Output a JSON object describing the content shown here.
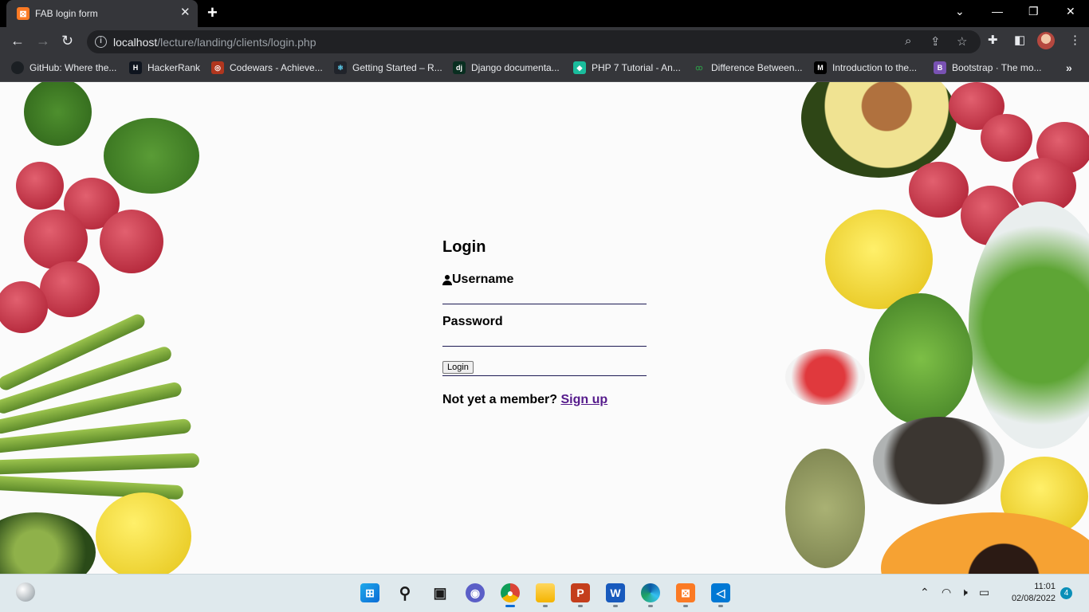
{
  "browser": {
    "tab": {
      "favicon": "xampp-icon",
      "title": "FAB login form",
      "close": "✕"
    },
    "new_tab": "+",
    "window_controls": [
      "⌄",
      "—",
      "❐",
      "✕"
    ],
    "url": {
      "host": "localhost",
      "path": "/lecture/landing/clients/login.php"
    },
    "bookmarks": [
      {
        "icon": "github-icon",
        "label": "GitHub: Where the...",
        "color": "#1b1f23"
      },
      {
        "icon": "hackerrank-icon",
        "label": "HackerRank",
        "color": "#0e141e"
      },
      {
        "icon": "codewars-icon",
        "label": "Codewars - Achieve...",
        "color": "#b1361e"
      },
      {
        "icon": "react-icon",
        "label": "Getting Started – R...",
        "color": "#20232a"
      },
      {
        "icon": "django-icon",
        "label": "Django documenta...",
        "color": "#092e20"
      },
      {
        "icon": "tutorial-icon",
        "label": "PHP 7 Tutorial - An...",
        "color": "#1abc9c"
      },
      {
        "icon": "geeksforgeeks-icon",
        "label": "Difference Between...",
        "color": "#2f8d46"
      },
      {
        "icon": "medium-icon",
        "label": "Introduction to the...",
        "color": "#000000"
      },
      {
        "icon": "bootstrap-icon",
        "label": "Bootstrap · The mo...",
        "color": "#7952b3"
      }
    ]
  },
  "login": {
    "title": "Login",
    "username_label": "Username",
    "password_label": "Password",
    "button": "Login",
    "signup_prompt": "Not yet a member?",
    "signup_link": "Sign up"
  },
  "taskbar": {
    "time": "11:01",
    "date": "02/08/2022",
    "notifications": "4"
  }
}
